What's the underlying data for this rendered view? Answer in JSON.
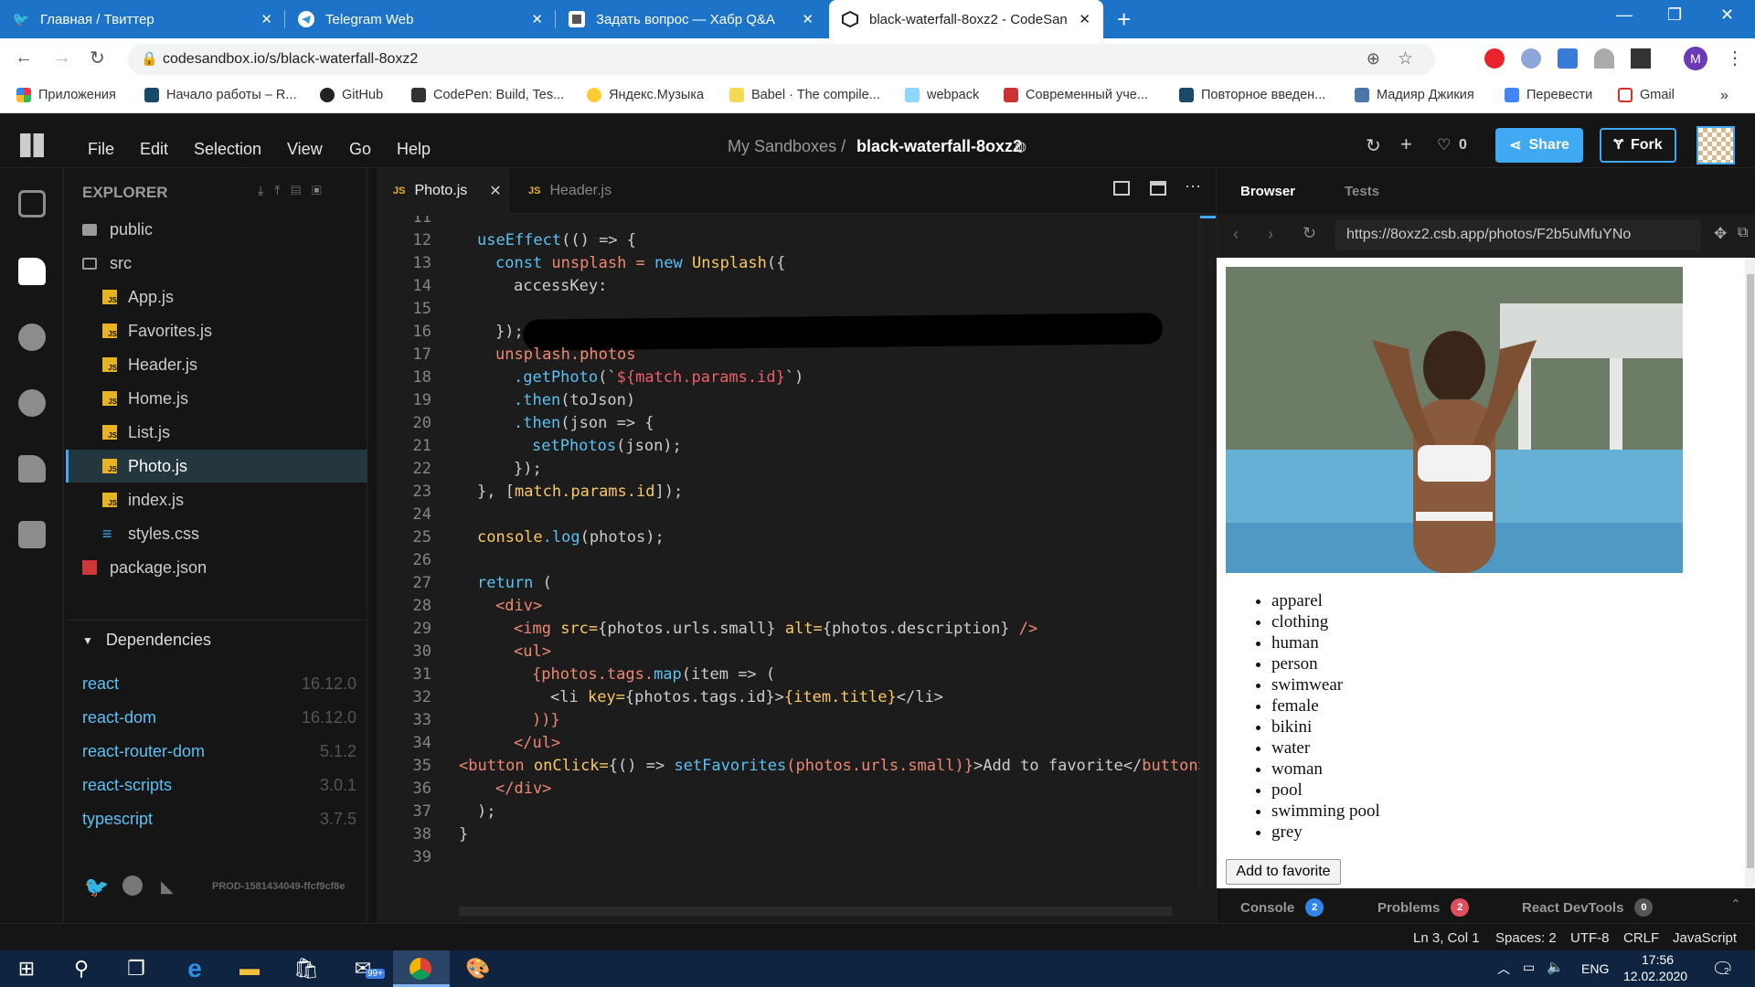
{
  "browser": {
    "tabs": [
      {
        "title": "Главная / Твиттер",
        "icon": "twitter-icon"
      },
      {
        "title": "Telegram Web",
        "icon": "telegram-icon"
      },
      {
        "title": "Задать вопрос — Хабр Q&A",
        "icon": "habr-icon"
      },
      {
        "title": "black-waterfall-8oxz2 - CodeSan",
        "icon": "codesandbox-icon"
      }
    ],
    "url": "codesandbox.io/s/black-waterfall-8oxz2",
    "bookmarks": [
      "Приложения",
      "Начало работы – R...",
      "GitHub",
      "CodePen: Build, Tes...",
      "Яндекс.Музыка",
      "Babel · The compile...",
      "webpack",
      "Современный уче...",
      "Повторное введен...",
      "Мадияр Джикия",
      "Перевести",
      "Gmail"
    ],
    "profile_initial": "M"
  },
  "header": {
    "menu": [
      "File",
      "Edit",
      "Selection",
      "View",
      "Go",
      "Help"
    ],
    "crumb": "My Sandboxes /",
    "sandbox": "black-waterfall-8oxz2",
    "likes": "0",
    "share": "Share",
    "fork": "Fork"
  },
  "explorer": {
    "title": "EXPLORER",
    "folders": [
      "public",
      "src"
    ],
    "files": [
      "App.js",
      "Favorites.js",
      "Header.js",
      "Home.js",
      "List.js",
      "Photo.js",
      "index.js",
      "styles.css"
    ],
    "root_file": "package.json",
    "deps_title": "Dependencies",
    "deps": [
      {
        "name": "react",
        "ver": "16.12.0"
      },
      {
        "name": "react-dom",
        "ver": "16.12.0"
      },
      {
        "name": "react-router-dom",
        "ver": "5.1.2"
      },
      {
        "name": "react-scripts",
        "ver": "3.0.1"
      },
      {
        "name": "typescript",
        "ver": "3.7.5"
      }
    ],
    "build": "PROD-1581434049-ffcf9cf8e"
  },
  "editor": {
    "tabs": [
      "Photo.js",
      "Header.js"
    ],
    "first_line": 11,
    "last_line": 39,
    "code": {
      "l11": "",
      "l12a": "useEffect",
      "l12b": "(() => {",
      "l13a": "const ",
      "l13b": "unsplash = ",
      "l13c": "new ",
      "l13d": "Unsplash",
      "l13e": "({",
      "l14": "accessKey:",
      "l16": "});",
      "l17": "unsplash.photos",
      "l18a": ".getPhoto",
      "l18b": "(`",
      "l18c": "${match.params.id}",
      "l18d": "`)",
      "l19a": ".then",
      "l19b": "(toJson)",
      "l20a": ".then",
      "l20b": "(json => {",
      "l21a": "setPhotos",
      "l21b": "(json);",
      "l22": "});",
      "l23a": "}, [",
      "l23b": "match.params.id",
      "l23c": "]);",
      "l25a": "console",
      "l25b": ".log",
      "l25c": "(photos);",
      "l27a": "return ",
      "l27b": "(",
      "l28": "<div>",
      "l29a": "<img ",
      "l29b": "src=",
      "l29c": "{photos.urls.small}",
      "l29d": " alt=",
      "l29e": "{photos.description}",
      "l29f": " />",
      "l30": "<ul>",
      "l31a": "{photos.tags.",
      "l31b": "map",
      "l31c": "(item => (",
      "l32a": "<li ",
      "l32b": "key=",
      "l32c": "{photos.tags.id}",
      "l32d": ">",
      "l32e": "{item.title}",
      "l32f": "</li>",
      "l33": "))}",
      "l34": "</ul>",
      "l35a": "<button ",
      "l35b": "onClick=",
      "l35c": "{() => ",
      "l35d": "setFavorites",
      "l35e": "(photos.urls.small)}",
      "l35f": ">Add to favorite</",
      "l35g": "button>",
      "l36": "</div>",
      "l37": ");",
      "l38": "}"
    }
  },
  "preview": {
    "tabs": [
      "Browser",
      "Tests"
    ],
    "url": "https://8oxz2.csb.app/photos/F2b5uMfuYNo",
    "tags": [
      "apparel",
      "clothing",
      "human",
      "person",
      "swimwear",
      "female",
      "bikini",
      "water",
      "woman",
      "pool",
      "swimming pool",
      "grey"
    ],
    "button": "Add to favorite",
    "bottom_tabs": [
      {
        "label": "Console",
        "count": "2",
        "color": "#2f86e8"
      },
      {
        "label": "Problems",
        "count": "2",
        "color": "#e04f5f"
      },
      {
        "label": "React DevTools",
        "count": "0",
        "color": "#555555"
      }
    ]
  },
  "status": [
    "Ln 3, Col 1",
    "Spaces: 2",
    "UTF-8",
    "CRLF",
    "JavaScript"
  ],
  "taskbar": {
    "lang": "ENG",
    "time": "17:56",
    "date": "12.02.2020",
    "mail_badge": "99+",
    "notif": "2"
  }
}
